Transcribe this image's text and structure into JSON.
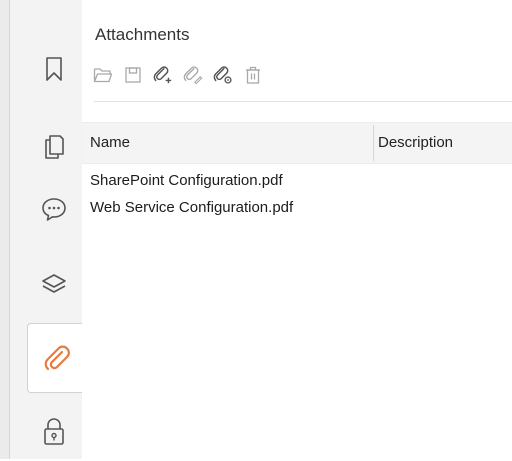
{
  "panel": {
    "title": "Attachments"
  },
  "nav": {
    "items": [
      {
        "icon": "bookmark-icon"
      },
      {
        "icon": "pages-icon"
      },
      {
        "icon": "comments-icon"
      },
      {
        "icon": "layers-icon"
      },
      {
        "icon": "attachment-icon",
        "active": true
      },
      {
        "icon": "lock-icon"
      }
    ]
  },
  "toolbar": {
    "buttons": [
      {
        "icon": "open-folder-icon"
      },
      {
        "icon": "save-icon"
      },
      {
        "icon": "add-attachment-icon"
      },
      {
        "icon": "edit-attachment-icon"
      },
      {
        "icon": "attachment-properties-icon"
      },
      {
        "icon": "delete-icon"
      }
    ]
  },
  "table": {
    "columns": [
      "Name",
      "Description"
    ],
    "rows": [
      {
        "name": "SharePoint Configuration.pdf",
        "description": ""
      },
      {
        "name": "Web Service Configuration.pdf",
        "description": ""
      }
    ]
  },
  "colors": {
    "accent": "#e97a3b",
    "icon": "#555555",
    "icon_disabled": "#a9a9a9"
  }
}
